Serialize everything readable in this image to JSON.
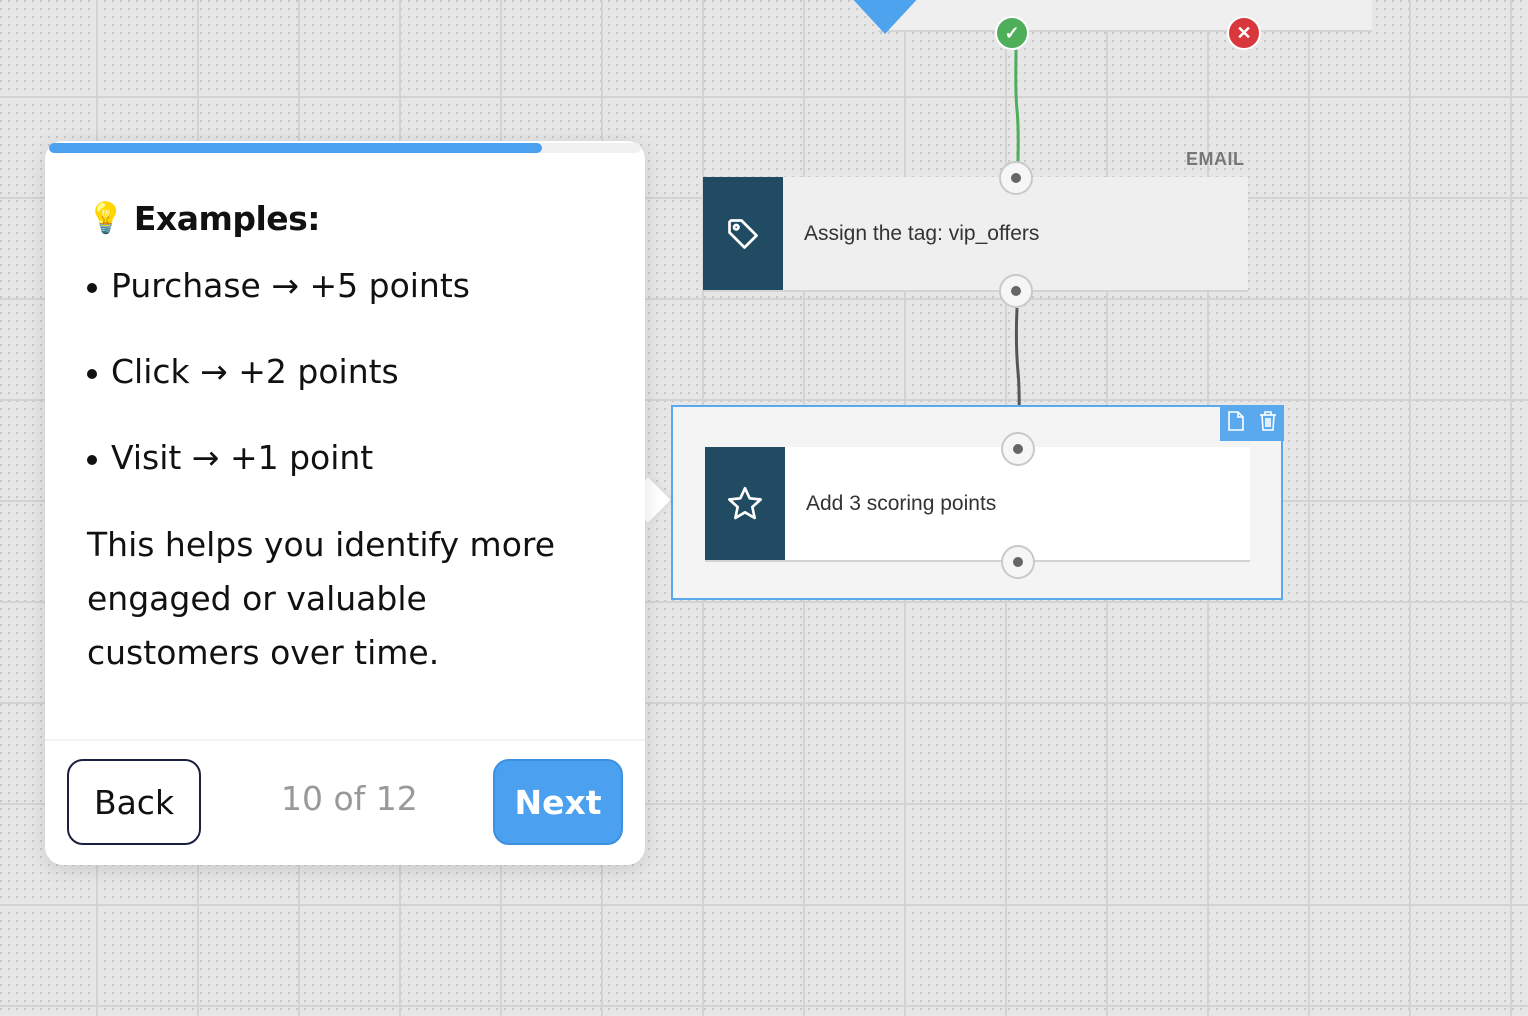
{
  "flow": {
    "channel_label": "EMAIL",
    "tag_node_label": "Assign the tag: vip_offers",
    "scoring_node_label": "Add 3 scoring points",
    "yes_badge": "✓",
    "no_badge": "✕"
  },
  "tour": {
    "progress_fraction": 0.833,
    "heading_icon": "💡",
    "heading": "Examples:",
    "examples": [
      "Purchase → +5 points",
      "Click → +2 points",
      "Visit → +1 point"
    ],
    "paragraph_lines": [
      "This helps you identify more",
      "engaged or valuable",
      "customers over time."
    ],
    "back_label": "Back",
    "next_label": "Next",
    "step_counter": "10 of 12"
  },
  "colors": {
    "accent": "#4ba0ef",
    "node_icon_bg": "#214a63",
    "success": "#4eae59",
    "danger": "#d8383b"
  }
}
